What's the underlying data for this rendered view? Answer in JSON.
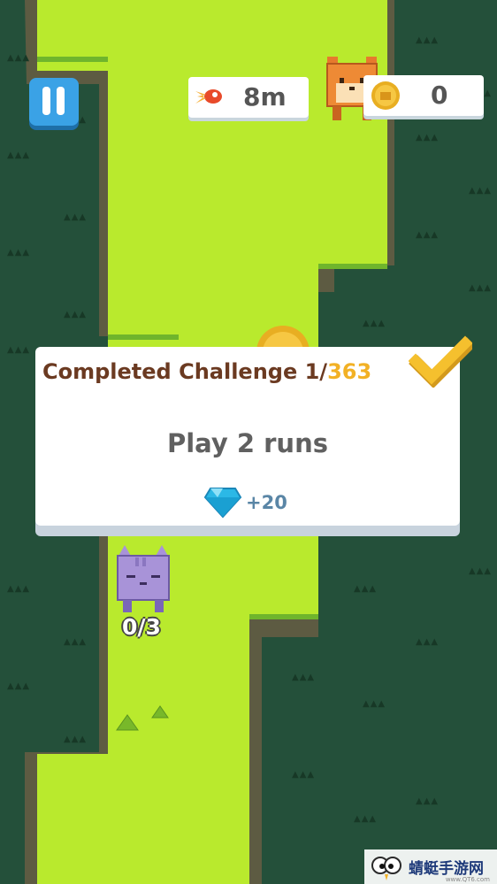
{
  "hud": {
    "pause_icon": "pause-icon",
    "distance_icon": "rocket-icon",
    "distance": "8m",
    "coin_icon": "coin-icon",
    "coins": "0",
    "character": "shiba-dog"
  },
  "challenge": {
    "title_prefix": "Completed Challenge 1/",
    "title_total": "363",
    "check_icon": "checkmark-icon",
    "task": "Play 2 runs",
    "reward_icon": "diamond-icon",
    "reward": "+20"
  },
  "target": {
    "character": "purple-cat",
    "progress": "0/3"
  },
  "watermark": {
    "text": "蜻蜓手游网",
    "sub": "www.QT6.com"
  },
  "colors": {
    "forest": "#24503a",
    "path": "#b9ea2d",
    "dirt": "#5d5b42",
    "accent": "#f2b125"
  }
}
